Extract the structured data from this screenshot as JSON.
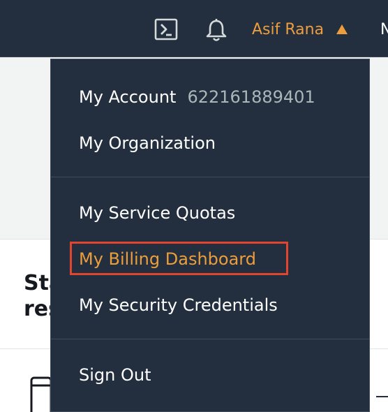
{
  "topbar": {
    "cloudshell_icon": "cloudshell-icon",
    "notifications_icon": "bell-icon",
    "user_name": "Asif Rana",
    "user_caret_icon": "caret-up-icon",
    "region_cut_text": "N"
  },
  "background": {
    "card_title": "Sta\nres",
    "device_icon": "device-icon"
  },
  "dropdown": {
    "items": [
      {
        "label": "My Account",
        "detail": "622161889401"
      },
      {
        "label": "My Organization"
      },
      {
        "label": "My Service Quotas"
      },
      {
        "label": "My Billing Dashboard",
        "highlighted": true
      },
      {
        "label": "My Security Credentials"
      },
      {
        "label": "Sign Out"
      }
    ]
  },
  "colors": {
    "nav_bg": "#232f3e",
    "accent_orange": "#ec9d3c",
    "highlight_border": "#e0452e",
    "account_id": "#aab7b8"
  }
}
